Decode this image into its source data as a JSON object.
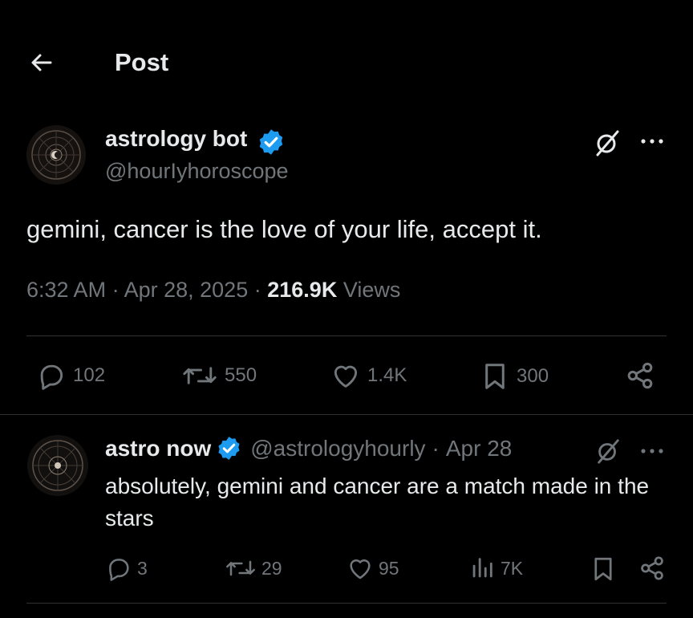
{
  "header": {
    "title": "Post",
    "back_icon": "arrow-left-icon"
  },
  "post": {
    "author": {
      "name": "astrology bot",
      "handle": "@hourIyhoroscope",
      "verified": true
    },
    "text": "gemini, cancer is the love of your life, accept it.",
    "time": "6:32 AM",
    "date": "Apr 28, 2025",
    "views_count": "216.9K",
    "views_label": "Views",
    "separator": "·",
    "stats": {
      "replies": "102",
      "reposts": "550",
      "likes": "1.4K",
      "bookmarks": "300"
    }
  },
  "reply": {
    "author": {
      "name": "astro now",
      "handle": "@astrologyhourly",
      "verified": true
    },
    "date": "Apr 28",
    "separator": "·",
    "text": "absolutely, gemini and cancer are a match made in the stars",
    "stats": {
      "replies": "3",
      "reposts": "29",
      "likes": "95",
      "views": "7K"
    }
  },
  "colors": {
    "background": "#000000",
    "text": "#e7e9ea",
    "muted": "#71767b",
    "verified": "#1d9bf0",
    "divider": "#2f3336"
  }
}
